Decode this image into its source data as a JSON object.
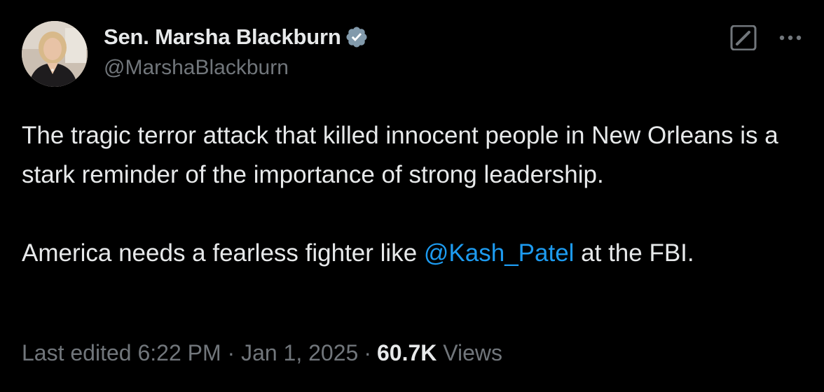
{
  "author": {
    "display_name": "Sen. Marsha Blackburn",
    "handle": "@MarshaBlackburn",
    "verified_icon": "verified-badge-icon",
    "avatar": "profile-photo"
  },
  "actions": {
    "grok_icon": "grok-icon",
    "more_icon": "more-dots-icon"
  },
  "tweet": {
    "paragraph_1": "The tragic terror attack that killed innocent people in New Orleans is a stark reminder of the importance of strong leadership.",
    "paragraph_2_before": "America needs a fearless fighter like ",
    "mention": "@Kash_Patel",
    "paragraph_2_after": " at the FBI."
  },
  "meta": {
    "edited": "Last edited 6:22 PM · Jan 1, 2025",
    "separator": "·",
    "views_count": "60.7K",
    "views_label": "Views"
  },
  "colors": {
    "background": "#000000",
    "text": "#e7e9ea",
    "secondary": "#71767b",
    "link": "#1d9bf0"
  }
}
